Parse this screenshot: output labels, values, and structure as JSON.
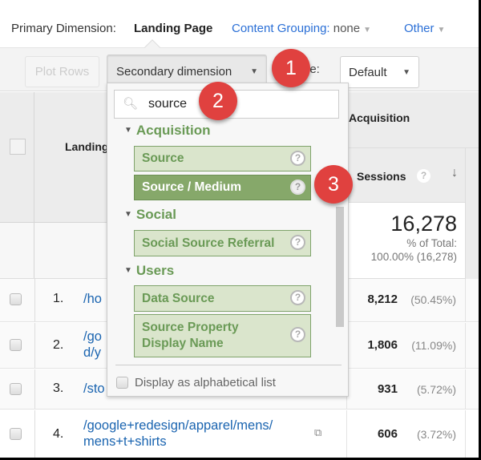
{
  "dimensions": {
    "label": "Primary Dimension:",
    "active": "Landing Page",
    "content_grouping_label": "Content Grouping:",
    "content_grouping_value": "none",
    "other": "Other"
  },
  "toolbar": {
    "plot_rows": "Plot Rows",
    "secondary_dimension": "Secondary dimension",
    "sort_type_label": "Sort Type:",
    "sort_type_visible": "pe:",
    "sort_type_value": "Default"
  },
  "table": {
    "checkbox_header": "",
    "landing_header": "Landing Page",
    "landing_header_visible": "Landing",
    "group_header": "Acquisition",
    "sessions_header": "Sessions",
    "total": {
      "value": "16,278",
      "pct_label": "% of Total:",
      "pct_value": "100.00% (16,278)"
    },
    "rows": [
      {
        "num": "1.",
        "page_visible": "/ho",
        "sessions": "8,212",
        "pct": "(50.45%)"
      },
      {
        "num": "2.",
        "page_visible_line1": "/go",
        "page_visible_line2": "d/y",
        "sessions": "1,806",
        "pct": "(11.09%)"
      },
      {
        "num": "3.",
        "page_visible": "/sto",
        "sessions": "931",
        "pct": "(5.72%)"
      },
      {
        "num": "4.",
        "page_line1": "/google+redesign/apparel/mens/",
        "page_line2": "mens+t+shirts",
        "sessions": "606",
        "pct": "(3.72%)"
      }
    ]
  },
  "dropdown": {
    "search_value": "source",
    "categories": [
      {
        "name": "Acquisition",
        "options": [
          {
            "label": "Source",
            "selected": false
          },
          {
            "label": "Source / Medium",
            "selected": true
          }
        ]
      },
      {
        "name": "Social",
        "options": [
          {
            "label": "Social Source Referral",
            "selected": false
          }
        ]
      },
      {
        "name": "Users",
        "options": [
          {
            "label": "Data Source",
            "selected": false
          },
          {
            "label": "Source Property Display Name",
            "selected": false
          }
        ]
      }
    ],
    "alphabetical_label": "Display as alphabetical list"
  },
  "callouts": [
    "1",
    "2",
    "3"
  ],
  "colors": {
    "callout": "#e0413f",
    "option_bg": "#dae5cc",
    "option_selected_bg": "#86a86a",
    "category_text": "#6a9a56",
    "link": "#1a64b0"
  }
}
